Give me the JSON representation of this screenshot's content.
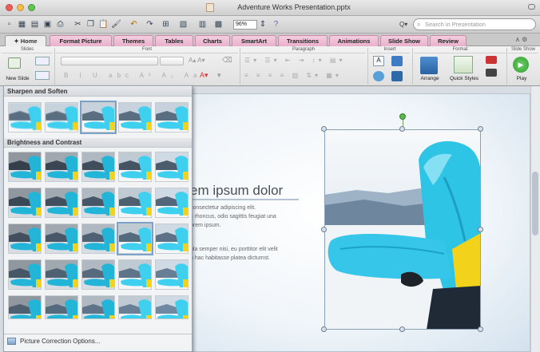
{
  "window": {
    "title": "Adventure Works Presentation.pptx"
  },
  "toolbar": {
    "zoom": "96%",
    "search_placeholder": "Search in Presentation"
  },
  "tabs": [
    {
      "label": "Home"
    },
    {
      "label": "Format Picture"
    },
    {
      "label": "Themes"
    },
    {
      "label": "Tables"
    },
    {
      "label": "Charts"
    },
    {
      "label": "SmartArt"
    },
    {
      "label": "Transitions"
    },
    {
      "label": "Animations"
    },
    {
      "label": "Slide Show"
    },
    {
      "label": "Review"
    }
  ],
  "ribbon": {
    "groups": {
      "slides": "Slides",
      "font": "Font",
      "paragraph": "Paragraph",
      "insert": "Insert",
      "format": "Format",
      "slide_show": "Slide Show"
    },
    "new_slide": "New Slide",
    "arrange": "Arrange",
    "quick_styles": "Quick Styles",
    "play": "Play"
  },
  "gallery": {
    "sharpen_heading": "Sharpen and Soften",
    "brightness_heading": "Brightness and Contrast",
    "correction_options": "Picture Correction Options...",
    "sharpen_selected_index": 2,
    "brightness_selected_index": 13
  },
  "slide": {
    "title": "em ipsum dolor",
    "body": [
      "consectetur adipiscing elit.",
      "s rhoncus, odio sagittis feugiat una",
      "orem ipsum.",
      "",
      "ula semper nisi, eu porttitor elit velit",
      "n hac habitasse platea dictumst."
    ]
  },
  "colors": {
    "accent_tab": "#e9b1cc",
    "snow_jacket": "#2ec4e6",
    "board_yellow": "#f2d21b"
  }
}
